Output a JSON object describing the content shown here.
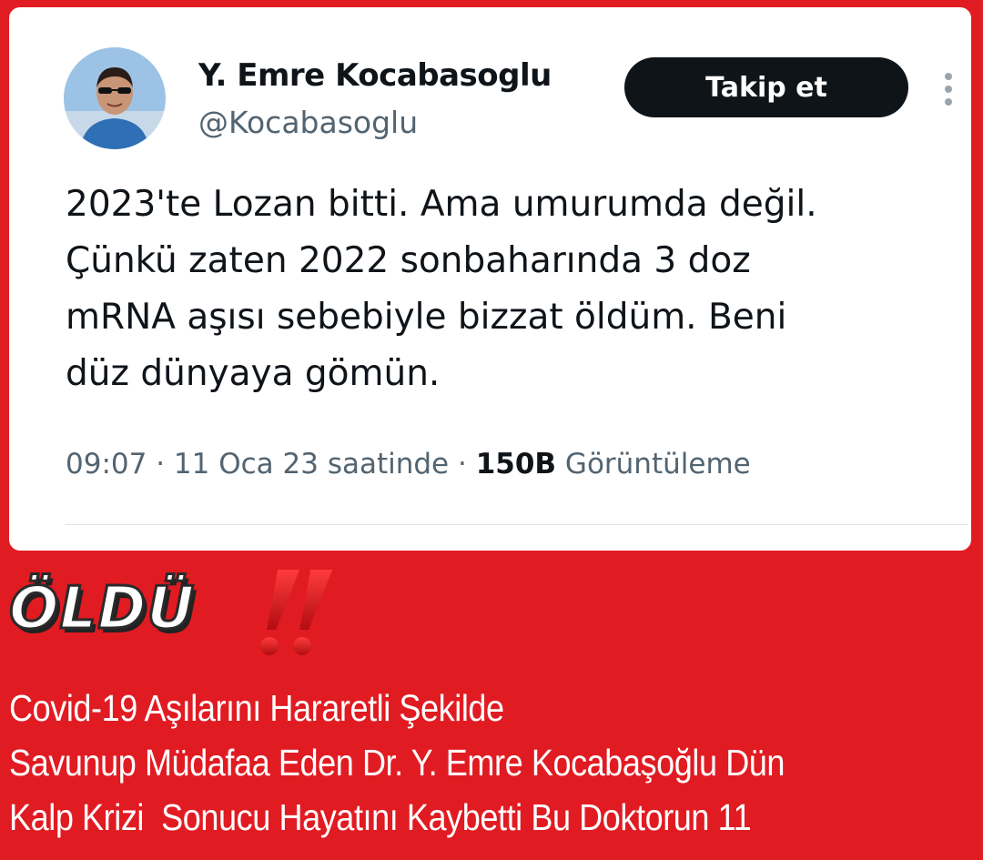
{
  "tweet": {
    "display_name": "Y. Emre Kocabasoglu",
    "handle": "@Kocabasoglu",
    "follow_label": "Takip et",
    "text_lines": [
      "2023'te Lozan bitti. Ama umurumda değil.",
      "Çünkü zaten 2022 sonbaharında 3 doz",
      "mRNA aşısı sebebiyle bizzat öldüm. Beni",
      "düz dünyaya gömün."
    ],
    "time": "09:07",
    "date": "11 Oca 23 saatinde",
    "views_count": "150B",
    "views_label": "Görüntüleme",
    "separator": "·"
  },
  "overlay": {
    "title": "ÖLDÜ",
    "headline_lines": [
      "Covid-19 Aşılarını Hararetli Şekilde",
      "Savunup Müdafaa Eden Dr. Y. Emre Kocabaşoğlu Dün",
      "Kalp Krizi  Sonucu Hayatını Kaybetti Bu Doktorun 11"
    ]
  },
  "icons": {
    "more": "more-vertical-icon",
    "exclamation": "double-exclamation-icon"
  },
  "colors": {
    "background": "#e11b22",
    "card": "#ffffff",
    "follow_button": "#0f1419",
    "exclamation": "#d9141b"
  }
}
